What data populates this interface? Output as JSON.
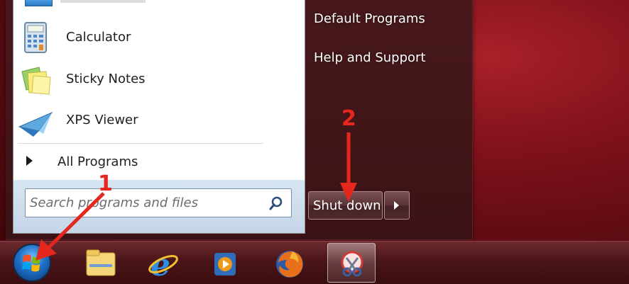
{
  "start_menu": {
    "programs": [
      {
        "label": "Calculator",
        "icon": "calculator-icon"
      },
      {
        "label": "Sticky Notes",
        "icon": "sticky-notes-icon"
      },
      {
        "label": "XPS Viewer",
        "icon": "xps-viewer-icon"
      }
    ],
    "all_programs_label": "All Programs",
    "search_placeholder": "Search programs and files",
    "right_items": [
      "Default Programs",
      "Help and Support"
    ],
    "shutdown_label": "Shut down"
  },
  "taskbar": {
    "pinned": [
      "windows-explorer-icon",
      "internet-explorer-icon",
      "windows-media-player-icon",
      "firefox-icon",
      "snipping-tool-icon"
    ]
  },
  "annotations": {
    "step1": "1",
    "step2": "2",
    "color": "#e5271d"
  }
}
